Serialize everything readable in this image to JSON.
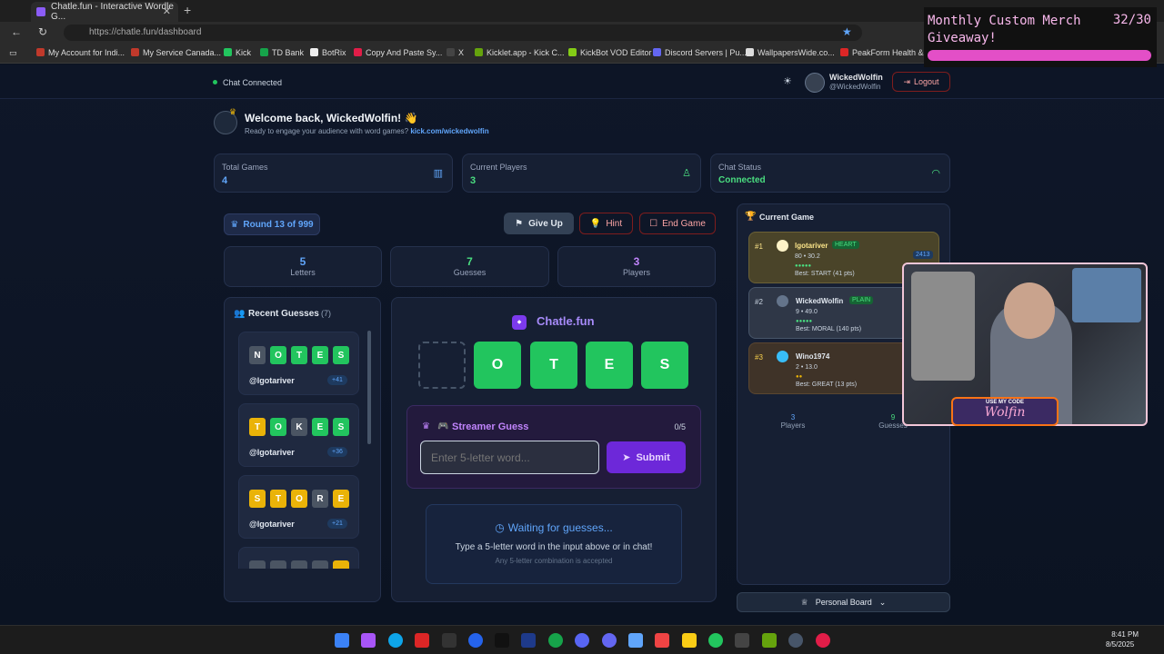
{
  "browser": {
    "tab_title": "Chatle.fun - Interactive Wordle G...",
    "url": "https://chatle.fun/dashboard",
    "bookmarks": [
      "My Account for Indi...",
      "My Service Canada...",
      "Kick",
      "TD Bank",
      "BotRix",
      "Copy And Paste Sy...",
      "X",
      "Kicklet.app - Kick C...",
      "KickBot VOD Editor",
      "Discord Servers | Pu...",
      "WallpapersWide.co...",
      "PeakForm Health &..."
    ]
  },
  "overlay": {
    "giveaway_text": "Monthly Custom Merch Giveaway!",
    "count": "32/30",
    "code_label": "USE MY CODE",
    "code": "Wolfin"
  },
  "header": {
    "chat_status": "Chat Connected",
    "username": "WickedWolfin",
    "handle": "@WickedWolfin",
    "logout": "Logout"
  },
  "welcome": {
    "title": "Welcome back, WickedWolfin! 👋",
    "subtitle": "Ready to engage your audience with word games?",
    "link": "kick.com/wickedwolfin"
  },
  "stats": [
    {
      "label": "Total Games",
      "value": "4"
    },
    {
      "label": "Current Players",
      "value": "3"
    },
    {
      "label": "Chat Status",
      "value": "Connected"
    }
  ],
  "round": "Round 13 of 999",
  "actions": {
    "give_up": "Give Up",
    "hint": "Hint",
    "end_game": "End Game"
  },
  "counters": [
    {
      "value": "5",
      "label": "Letters"
    },
    {
      "value": "7",
      "label": "Guesses"
    },
    {
      "value": "3",
      "label": "Players"
    }
  ],
  "recent": {
    "title": "Recent Guesses",
    "count": "(7)",
    "items": [
      {
        "letters": [
          "N",
          "O",
          "T",
          "E",
          "S"
        ],
        "colors": [
          "k",
          "g",
          "g",
          "g",
          "g"
        ],
        "user": "@lgotariver",
        "points": "+41"
      },
      {
        "letters": [
          "T",
          "O",
          "K",
          "E",
          "S"
        ],
        "colors": [
          "y",
          "g",
          "k",
          "g",
          "g"
        ],
        "user": "@lgotariver",
        "points": "+36"
      },
      {
        "letters": [
          "S",
          "T",
          "O",
          "R",
          "E"
        ],
        "colors": [
          "y",
          "y",
          "y",
          "k",
          "y"
        ],
        "user": "@lgotariver",
        "points": "+21"
      }
    ]
  },
  "board": {
    "brand": "Chatle.fun",
    "letters": [
      "",
      "O",
      "T",
      "E",
      "S"
    ],
    "streamer_label": "Streamer Guess",
    "streamer_count": "0/5",
    "input_placeholder": "Enter 5-letter word...",
    "submit": "Submit",
    "waiting_title": "Waiting for guesses...",
    "waiting_sub": "Type a 5-letter word in the input above or in chat!",
    "waiting_note": "Any 5-letter combination is accepted"
  },
  "current_game": {
    "title": "Current Game",
    "players": [
      {
        "rank": "#1",
        "name": "lgotariver",
        "tag": "HEART",
        "stats": "80 • 30.2",
        "best": "Best: START (41 pts)",
        "score": "2413"
      },
      {
        "rank": "#2",
        "name": "WickedWolfin",
        "tag": "PLAIN",
        "stats": "9 • 49.0",
        "best": "Best: MORAL (140 pts)",
        "score": ""
      },
      {
        "rank": "#3",
        "name": "Wino1974",
        "tag": "",
        "stats": "2 • 13.0",
        "best": "Best: GREAT (13 pts)",
        "score": ""
      }
    ],
    "footer": [
      {
        "value": "3",
        "label": "Players"
      },
      {
        "value": "9",
        "label": "Guesses"
      }
    ],
    "personal_board": "Personal Board"
  },
  "taskbar": {
    "time": "8:41 PM",
    "date": "8/5/2025"
  }
}
